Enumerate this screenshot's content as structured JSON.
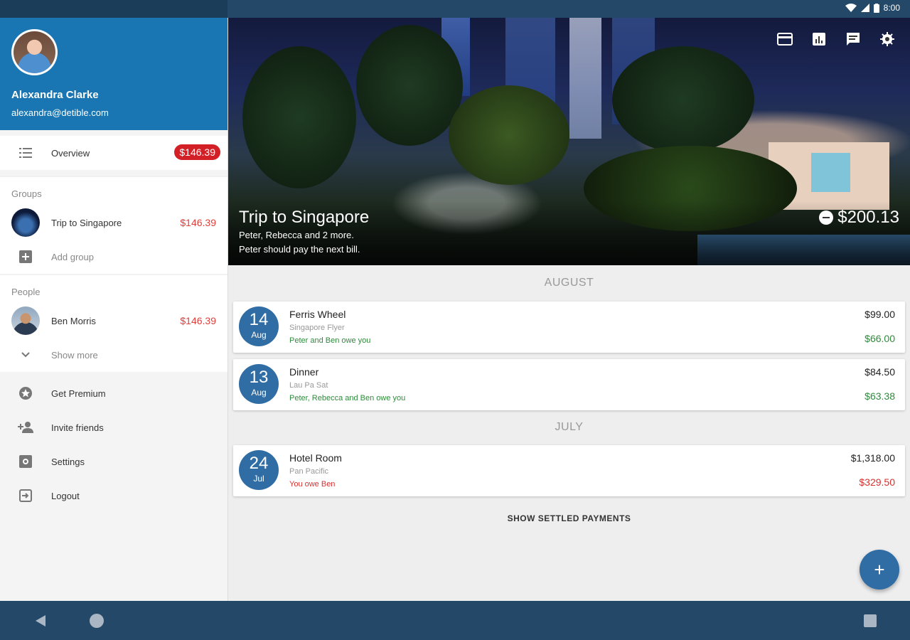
{
  "status": {
    "time": "8:00"
  },
  "drawer": {
    "user_name": "Alexandra Clarke",
    "user_email": "alexandra@detible.com",
    "overview_label": "Overview",
    "overview_badge": "$146.39",
    "groups_header": "Groups",
    "groups": [
      {
        "label": "Trip to Singapore",
        "amount": "$146.39"
      }
    ],
    "add_group_label": "Add group",
    "people_header": "People",
    "people": [
      {
        "label": "Ben Morris",
        "amount": "$146.39"
      }
    ],
    "show_more_label": "Show more",
    "menu": [
      {
        "label": "Get Premium",
        "icon": "star-icon"
      },
      {
        "label": "Invite friends",
        "icon": "person-add-icon"
      },
      {
        "label": "Settings",
        "icon": "settings-icon"
      },
      {
        "label": "Logout",
        "icon": "logout-icon"
      }
    ]
  },
  "group": {
    "title": "Trip to Singapore",
    "members": "Peter, Rebecca and 2 more.",
    "next_payer": "Peter should pay the next bill.",
    "total": "$200.13"
  },
  "months": [
    "AUGUST",
    "JULY"
  ],
  "expenses": [
    {
      "day": "14",
      "month": "Aug",
      "title": "Ferris Wheel",
      "place": "Singapore Flyer",
      "note": "Peter and Ben owe you",
      "price": "$99.00",
      "share": "$66.00",
      "status": "owed"
    },
    {
      "day": "13",
      "month": "Aug",
      "title": "Dinner",
      "place": "Lau Pa Sat",
      "note": "Peter, Rebecca and Ben owe you",
      "price": "$84.50",
      "share": "$63.38",
      "status": "owed"
    },
    {
      "day": "24",
      "month": "Jul",
      "title": "Hotel Room",
      "place": "Pan Pacific",
      "note": "You owe Ben",
      "price": "$1,318.00",
      "share": "$329.50",
      "status": "owe"
    }
  ],
  "show_settled_label": "SHOW SETTLED PAYMENTS",
  "fab_label": "+",
  "colors": {
    "primary": "#1976b2",
    "accent": "#2f6da4",
    "positive": "#2e8b3b",
    "negative": "#d9302f",
    "badge": "#d32027"
  }
}
